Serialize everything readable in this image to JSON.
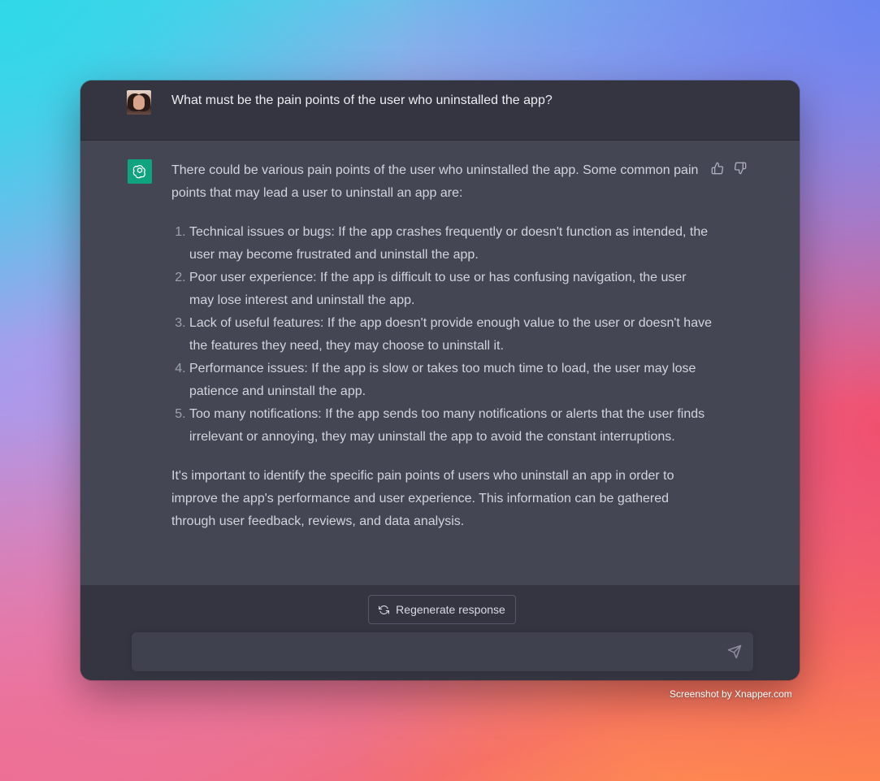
{
  "conversation": {
    "user_message": "What must be the pain points of the user who uninstalled the app?",
    "assistant": {
      "intro": "There could be various pain points of the user who uninstalled the app. Some common pain points that may lead a user to uninstall an app are:",
      "items": [
        "Technical issues or bugs: If the app crashes frequently or doesn't function as intended, the user may become frustrated and uninstall the app.",
        "Poor user experience: If the app is difficult to use or has confusing navigation, the user may lose interest and uninstall the app.",
        "Lack of useful features: If the app doesn't provide enough value to the user or doesn't have the features they need, they may choose to uninstall it.",
        "Performance issues: If the app is slow or takes too much time to load, the user may lose patience and uninstall the app.",
        "Too many notifications: If the app sends too many notifications or alerts that the user finds irrelevant or annoying, they may uninstall the app to avoid the constant interruptions."
      ],
      "conclusion": "It's important to identify the specific pain points of users who uninstall an app in order to improve the app's performance and user experience. This information can be gathered through user feedback, reviews, and data analysis."
    }
  },
  "footer": {
    "regenerate_label": "Regenerate response",
    "input_value": "",
    "input_placeholder": ""
  },
  "credit": "Screenshot by Xnapper.com",
  "icons": {
    "bot": "openai-logo-icon",
    "thumbs_up": "thumbs-up-icon",
    "thumbs_down": "thumbs-down-icon",
    "regenerate": "refresh-icon",
    "send": "send-icon"
  },
  "colors": {
    "user_bg": "#343541",
    "assistant_bg": "#444654",
    "bot_avatar": "#10a37f",
    "text": "#d1d5db"
  }
}
